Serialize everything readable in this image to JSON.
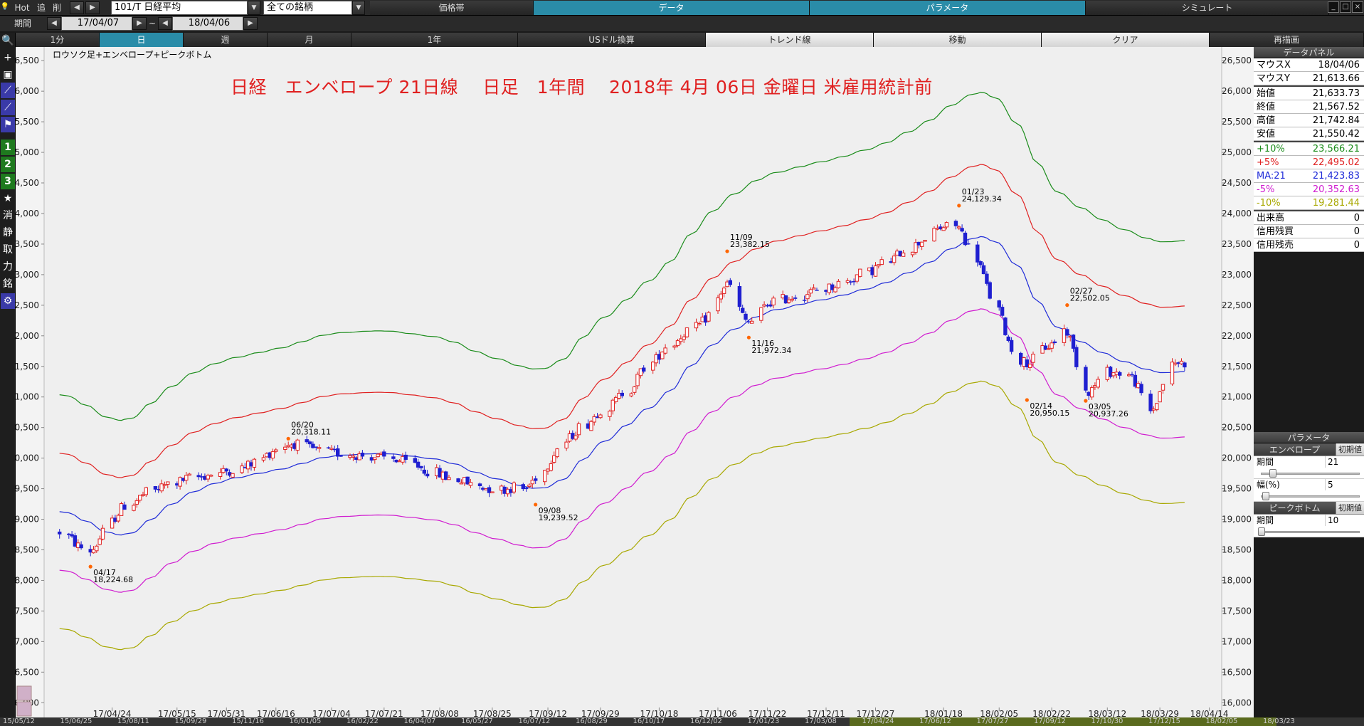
{
  "toolbar": {
    "hot": "Hot",
    "add": "追",
    "del": "削",
    "symbol": "101/T 日経平均",
    "universe": "全ての銘柄",
    "tabs": [
      {
        "label": "価格帯",
        "active": false
      },
      {
        "label": "データ",
        "active": true
      },
      {
        "label": "パラメータ",
        "active": true
      },
      {
        "label": "シミュレート",
        "active": false
      }
    ]
  },
  "period_bar": {
    "label": "期間",
    "from": "17/04/07",
    "tilde": "~",
    "to": "18/04/06"
  },
  "interval_tabs": [
    {
      "label": "1分",
      "style": "dark"
    },
    {
      "label": "日",
      "style": "on"
    },
    {
      "label": "週",
      "style": "dark"
    },
    {
      "label": "月",
      "style": "dark"
    },
    {
      "label": "1年",
      "style": "dark"
    },
    {
      "label": "USドル換算",
      "style": "dark"
    },
    {
      "label": "トレンド線",
      "style": "light"
    },
    {
      "label": "移動",
      "style": "light"
    },
    {
      "label": "クリア",
      "style": "light"
    },
    {
      "label": "再描画",
      "style": "dark"
    }
  ],
  "left_tools": [
    {
      "name": "search-icon",
      "glyph": "🔍"
    },
    {
      "name": "crosshair-icon",
      "glyph": "+"
    },
    {
      "name": "camera-icon",
      "glyph": "▣"
    },
    {
      "name": "chart-line-icon",
      "glyph": "⟋"
    },
    {
      "name": "chart-multi-icon",
      "glyph": "⟋"
    },
    {
      "name": "flag-icon",
      "glyph": "⚑"
    },
    {
      "name": "layout-1-button",
      "glyph": "1"
    },
    {
      "name": "layout-2-button",
      "glyph": "2"
    },
    {
      "name": "layout-3-button",
      "glyph": "3"
    },
    {
      "name": "favorite-icon",
      "glyph": "★"
    },
    {
      "name": "erase-button",
      "glyph": "消"
    },
    {
      "name": "static-button",
      "glyph": "静"
    },
    {
      "name": "trade-button",
      "glyph": "取"
    },
    {
      "name": "force-button",
      "glyph": "力"
    },
    {
      "name": "stock-button",
      "glyph": "銘"
    },
    {
      "name": "settings-icon",
      "glyph": "⚙"
    }
  ],
  "chart_caption": "ロウソク足+エンベロープ+ピークボトム",
  "chart_title": "日経　エンベロープ 21日線　 日足　1年間　 2018年 4月 06日 金曜日 米雇用統計前",
  "data_panel": {
    "title": "データパネル",
    "rows_a": [
      {
        "label": "マウスX",
        "value": "18/04/06"
      },
      {
        "label": "マウスY",
        "value": "21,613.66"
      }
    ],
    "rows_b": [
      {
        "label": "始値",
        "value": "21,633.73"
      },
      {
        "label": "終値",
        "value": "21,567.52"
      },
      {
        "label": "高値",
        "value": "21,742.84"
      },
      {
        "label": "安値",
        "value": "21,550.42"
      }
    ],
    "rows_c": [
      {
        "label": "+10%",
        "value": "23,566.21",
        "color": "#1a8c1a"
      },
      {
        "label": "+5%",
        "value": "22,495.02",
        "color": "#e02020"
      },
      {
        "label": "MA:21",
        "value": "21,423.83",
        "color": "#1f2bd8"
      },
      {
        "label": "-5%",
        "value": "20,352.63",
        "color": "#d01cd0"
      },
      {
        "label": "-10%",
        "value": "19,281.44",
        "color": "#a8a800"
      }
    ],
    "rows_d": [
      {
        "label": "出来高",
        "value": "0"
      },
      {
        "label": "信用残買",
        "value": "0"
      },
      {
        "label": "信用残売",
        "value": "0"
      }
    ]
  },
  "param_panel": {
    "title": "パラメータ",
    "envelope": {
      "name": "エンベロープ",
      "reset": "初期値",
      "period_label": "期間",
      "period": "21",
      "width_label": "幅(%)",
      "width": "5"
    },
    "peak": {
      "name": "ピークボトム",
      "reset": "初期値",
      "period_label": "期間",
      "period": "10"
    }
  },
  "bottom_labels": [
    "15/05/12",
    "15/06/25",
    "15/08/11",
    "15/09/29",
    "15/11/16",
    "16/01/05",
    "16/02/22",
    "16/04/07",
    "16/05/27",
    "16/07/12",
    "16/08/29",
    "16/10/17",
    "16/12/02",
    "17/01/23",
    "17/03/08",
    "17/04/24",
    "17/06/12",
    "17/07/27",
    "17/09/12",
    "17/10/30",
    "17/12/15",
    "18/02/05",
    "18/03/23"
  ],
  "chart_data": {
    "type": "candlestick",
    "ylim": [
      16000,
      27000
    ],
    "yticks": [
      16000,
      16500,
      17000,
      17500,
      18000,
      18500,
      19000,
      19500,
      20000,
      20500,
      21000,
      21500,
      22000,
      22500,
      23000,
      23500,
      24000,
      24500,
      25000,
      25500,
      26000,
      26500
    ],
    "ytick_labels": [
      "16,000",
      "16,500",
      "17,000",
      "17,500",
      "18,000",
      "18,500",
      "19,000",
      "19,500",
      "20,000",
      "20,500",
      "21,000",
      "21,500",
      "22,000",
      "22,500",
      "23,000",
      "23,500",
      "24,000",
      "24,500",
      "25,000",
      "25,500",
      "26,000",
      "26,500"
    ],
    "xtick_labels": [
      "17/04/24",
      "17/05/15",
      "17/05/31",
      "17/06/16",
      "17/07/04",
      "17/07/21",
      "17/08/08",
      "17/08/25",
      "17/09/12",
      "17/09/29",
      "17/10/18",
      "17/11/06",
      "17/11/22",
      "17/12/11",
      "17/12/27",
      "18/01/18",
      "18/02/05",
      "18/02/22",
      "18/03/12",
      "18/03/29",
      "18/04/14"
    ],
    "colors": {
      "up": "#e02020",
      "down": "#1f1fd0",
      "ma": "#1f2bd8",
      "plus10": "#1a8c1a",
      "plus5": "#e02020",
      "minus5": "#d01cd0",
      "minus10": "#a8a800",
      "peak": "#ff6600"
    },
    "ma21_anchors": [
      [
        "17/04/07",
        19200
      ],
      [
        "17/04/17",
        18930
      ],
      [
        "17/04/24",
        18720
      ],
      [
        "17/05/01",
        18760
      ],
      [
        "17/05/10",
        19150
      ],
      [
        "17/05/22",
        19500
      ],
      [
        "17/06/01",
        19660
      ],
      [
        "17/06/16",
        19800
      ],
      [
        "17/07/04",
        20040
      ],
      [
        "17/07/21",
        20080
      ],
      [
        "17/08/08",
        19980
      ],
      [
        "17/08/25",
        19680
      ],
      [
        "17/09/08",
        19480
      ],
      [
        "17/09/15",
        19560
      ],
      [
        "17/09/29",
        20240
      ],
      [
        "17/10/18",
        20920
      ],
      [
        "17/11/01",
        21700
      ],
      [
        "17/11/09",
        22050
      ],
      [
        "17/11/22",
        22400
      ],
      [
        "17/12/11",
        22600
      ],
      [
        "17/12/27",
        22800
      ],
      [
        "18/01/10",
        23100
      ],
      [
        "18/01/23",
        23500
      ],
      [
        "18/02/01",
        23680
      ],
      [
        "18/02/09",
        23300
      ],
      [
        "18/02/22",
        22200
      ],
      [
        "18/03/05",
        21850
      ],
      [
        "18/03/16",
        21600
      ],
      [
        "18/03/29",
        21380
      ],
      [
        "18/04/06",
        21424
      ]
    ],
    "peaks": [
      {
        "date": "17/04/17",
        "value": 18224.68,
        "label_date": "04/17",
        "label_value": "18,224.68",
        "pos": "below"
      },
      {
        "date": "17/06/20",
        "value": 20318.11,
        "label_date": "06/20",
        "label_value": "20,318.11",
        "pos": "above"
      },
      {
        "date": "17/09/08",
        "value": 19239.52,
        "label_date": "09/08",
        "label_value": "19,239.52",
        "pos": "below"
      },
      {
        "date": "17/11/09",
        "value": 23382.15,
        "label_date": "11/09",
        "label_value": "23,382.15",
        "pos": "above"
      },
      {
        "date": "17/11/16",
        "value": 21972.34,
        "label_date": "11/16",
        "label_value": "21,972.34",
        "pos": "below"
      },
      {
        "date": "18/01/23",
        "value": 24129.34,
        "label_date": "01/23",
        "label_value": "24,129.34",
        "pos": "above"
      },
      {
        "date": "18/02/14",
        "value": 20950.15,
        "label_date": "02/14",
        "label_value": "20,950.15",
        "pos": "below"
      },
      {
        "date": "18/02/27",
        "value": 22502.05,
        "label_date": "02/27",
        "label_value": "22,502.05",
        "pos": "above"
      },
      {
        "date": "18/03/05",
        "value": 20937.26,
        "label_date": "03/05",
        "label_value": "20,937.26",
        "pos": "below"
      }
    ],
    "last_candle": {
      "date": "18/04/06",
      "open": 21633.73,
      "high": 21742.84,
      "low": 21550.42,
      "close": 21567.52
    }
  }
}
